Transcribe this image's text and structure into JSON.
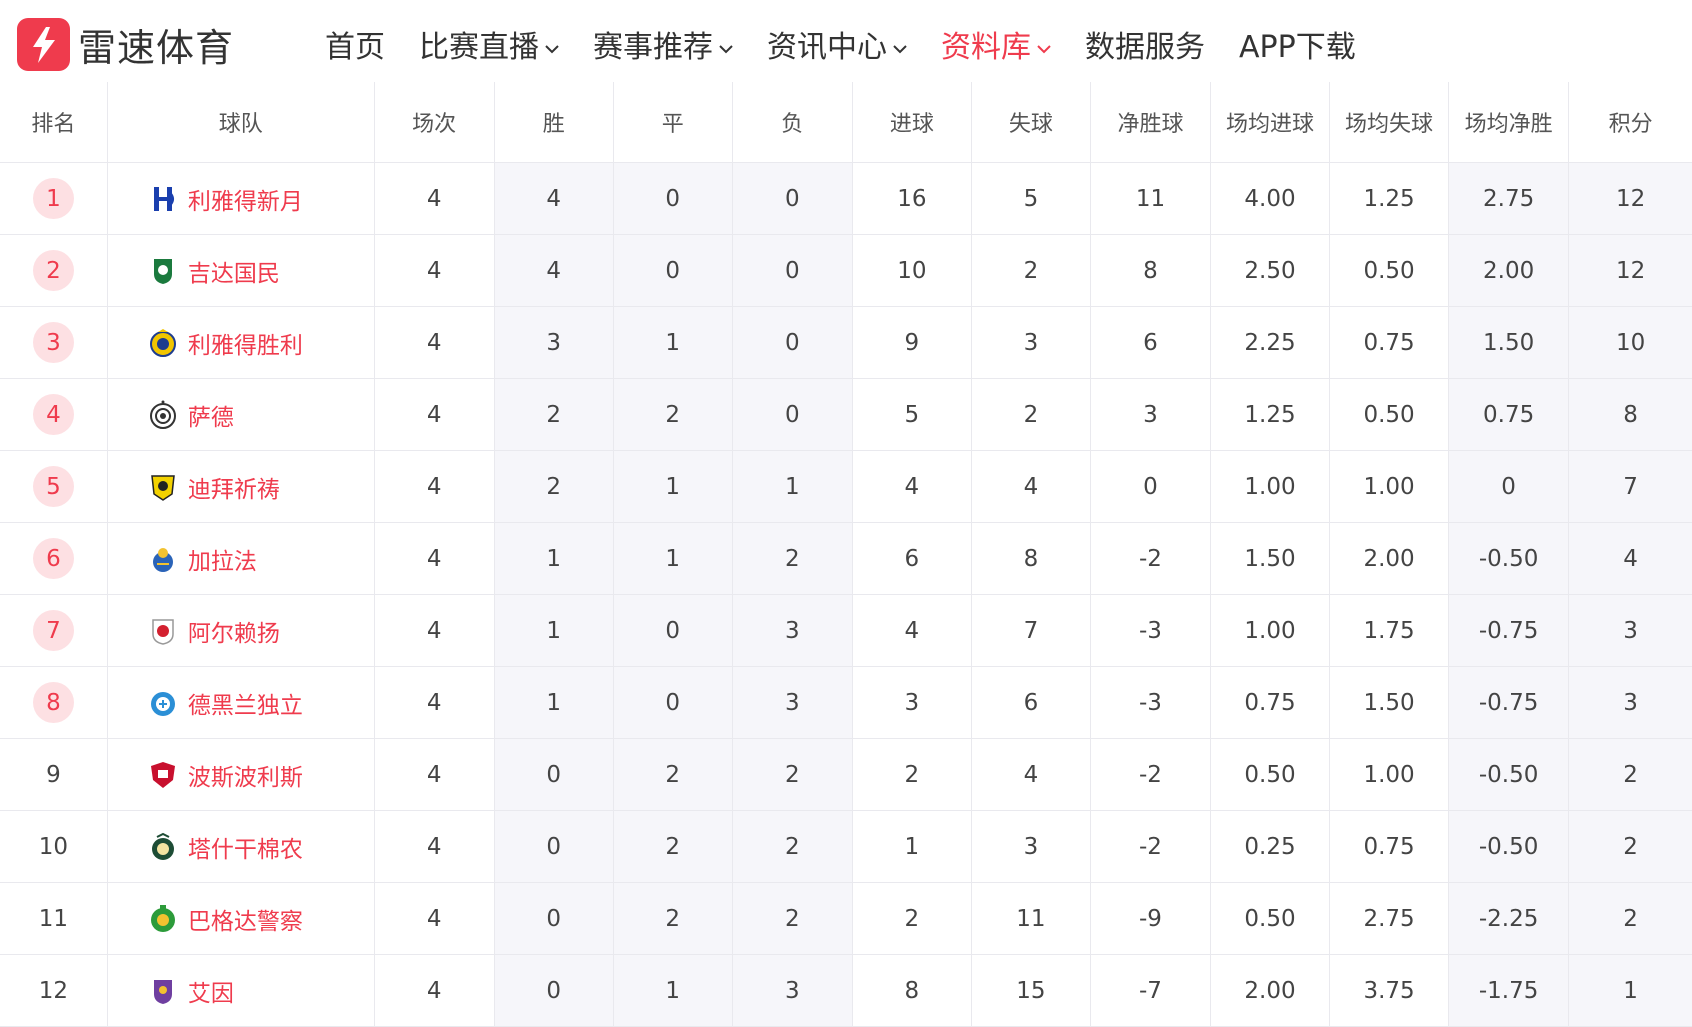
{
  "brand": {
    "name": "雷速体育",
    "color": "#ef3b4d"
  },
  "nav": [
    {
      "label": "首页",
      "dropdown": false,
      "active": false
    },
    {
      "label": "比赛直播",
      "dropdown": true,
      "active": false
    },
    {
      "label": "赛事推荐",
      "dropdown": true,
      "active": false
    },
    {
      "label": "资讯中心",
      "dropdown": true,
      "active": false
    },
    {
      "label": "资料库",
      "dropdown": true,
      "active": true
    },
    {
      "label": "数据服务",
      "dropdown": false,
      "active": false
    },
    {
      "label": "APP下载",
      "dropdown": false,
      "active": false
    }
  ],
  "table": {
    "headers": [
      "排名",
      "球队",
      "场次",
      "胜",
      "平",
      "负",
      "进球",
      "失球",
      "净胜球",
      "场均进球",
      "场均失球",
      "场均净胜",
      "积分"
    ],
    "rows": [
      {
        "rank": "1",
        "team": "利雅得新月",
        "logo": "hilal-logo",
        "cells": [
          "4",
          "4",
          "0",
          "0",
          "16",
          "5",
          "11",
          "4.00",
          "1.25",
          "2.75",
          "12"
        ]
      },
      {
        "rank": "2",
        "team": "吉达国民",
        "logo": "ahli-logo",
        "cells": [
          "4",
          "4",
          "0",
          "0",
          "10",
          "2",
          "8",
          "2.50",
          "0.50",
          "2.00",
          "12"
        ]
      },
      {
        "rank": "3",
        "team": "利雅得胜利",
        "logo": "nassr-logo",
        "cells": [
          "4",
          "3",
          "1",
          "0",
          "9",
          "3",
          "6",
          "2.25",
          "0.75",
          "1.50",
          "10"
        ]
      },
      {
        "rank": "4",
        "team": "萨德",
        "logo": "sadd-logo",
        "cells": [
          "4",
          "2",
          "2",
          "0",
          "5",
          "2",
          "3",
          "1.25",
          "0.50",
          "0.75",
          "8"
        ]
      },
      {
        "rank": "5",
        "team": "迪拜祈祷",
        "logo": "wasl-logo",
        "cells": [
          "4",
          "2",
          "1",
          "1",
          "4",
          "4",
          "0",
          "1.00",
          "1.00",
          "0",
          "7"
        ]
      },
      {
        "rank": "6",
        "team": "加拉法",
        "logo": "gharafa-logo",
        "cells": [
          "4",
          "1",
          "1",
          "2",
          "6",
          "8",
          "-2",
          "1.50",
          "2.00",
          "-0.50",
          "4"
        ]
      },
      {
        "rank": "7",
        "team": "阿尔赖扬",
        "logo": "rayyan-logo",
        "cells": [
          "4",
          "1",
          "0",
          "3",
          "4",
          "7",
          "-3",
          "1.00",
          "1.75",
          "-0.75",
          "3"
        ]
      },
      {
        "rank": "8",
        "team": "德黑兰独立",
        "logo": "esteghlal-logo",
        "cells": [
          "4",
          "1",
          "0",
          "3",
          "3",
          "6",
          "-3",
          "0.75",
          "1.50",
          "-0.75",
          "3"
        ]
      },
      {
        "rank": "9",
        "team": "波斯波利斯",
        "logo": "persepolis-logo",
        "cells": [
          "4",
          "0",
          "2",
          "2",
          "2",
          "4",
          "-2",
          "0.50",
          "1.00",
          "-0.50",
          "2"
        ]
      },
      {
        "rank": "10",
        "team": "塔什干棉农",
        "logo": "pakhtakor-logo",
        "cells": [
          "4",
          "0",
          "2",
          "2",
          "1",
          "3",
          "-2",
          "0.25",
          "0.75",
          "-0.50",
          "2"
        ]
      },
      {
        "rank": "11",
        "team": "巴格达警察",
        "logo": "shorta-logo",
        "cells": [
          "4",
          "0",
          "2",
          "2",
          "2",
          "11",
          "-9",
          "0.50",
          "2.75",
          "-2.25",
          "2"
        ]
      },
      {
        "rank": "12",
        "team": "艾因",
        "logo": "ain-logo",
        "cells": [
          "4",
          "0",
          "1",
          "3",
          "8",
          "15",
          "-7",
          "2.00",
          "3.75",
          "-1.75",
          "1"
        ]
      }
    ]
  }
}
